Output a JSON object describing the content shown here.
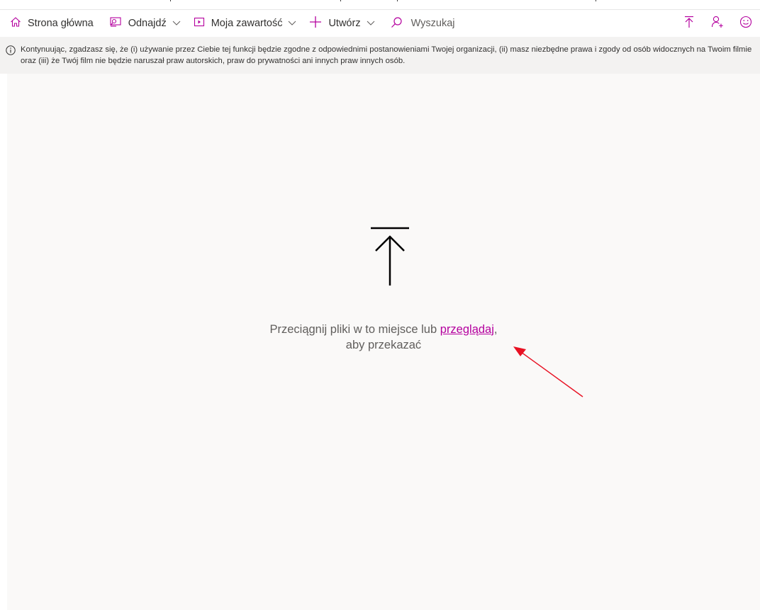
{
  "nav": {
    "home": "Strona główna",
    "discover": "Odnajdź",
    "my_content": "Moja zawartość",
    "create": "Utwórz",
    "search_placeholder": "Wyszukaj"
  },
  "banner": {
    "text": "Kontynuując, zgadzasz się, że (i) używanie przez Ciebie tej funkcji będzie zgodne z odpowiednimi postanowieniami Twojej organizacji, (ii) masz niezbędne prawa i zgody od osób widocznych na Twoim filmie oraz (iii) że Twój film nie będzie naruszał praw autorskich, praw do prywatności ani innych praw innych osób."
  },
  "dropzone": {
    "text_before": "Przeciągnij pliki w to miejsce lub",
    "browse_link": "przeglądaj",
    "text_after": ",",
    "line2": "aby przekazać"
  },
  "icons": {
    "home": "home-icon",
    "discover": "discover-icon",
    "my_content": "video-icon",
    "create": "plus-icon",
    "search": "search-icon",
    "upload": "upload-icon",
    "add_person": "add-person-icon",
    "feedback": "smiley-icon",
    "info": "info-icon"
  },
  "colors": {
    "accent": "#b4009e",
    "annotation_arrow": "#e81123",
    "banner_bg": "#f3f2f1",
    "dropzone_bg": "#faf9f8"
  }
}
